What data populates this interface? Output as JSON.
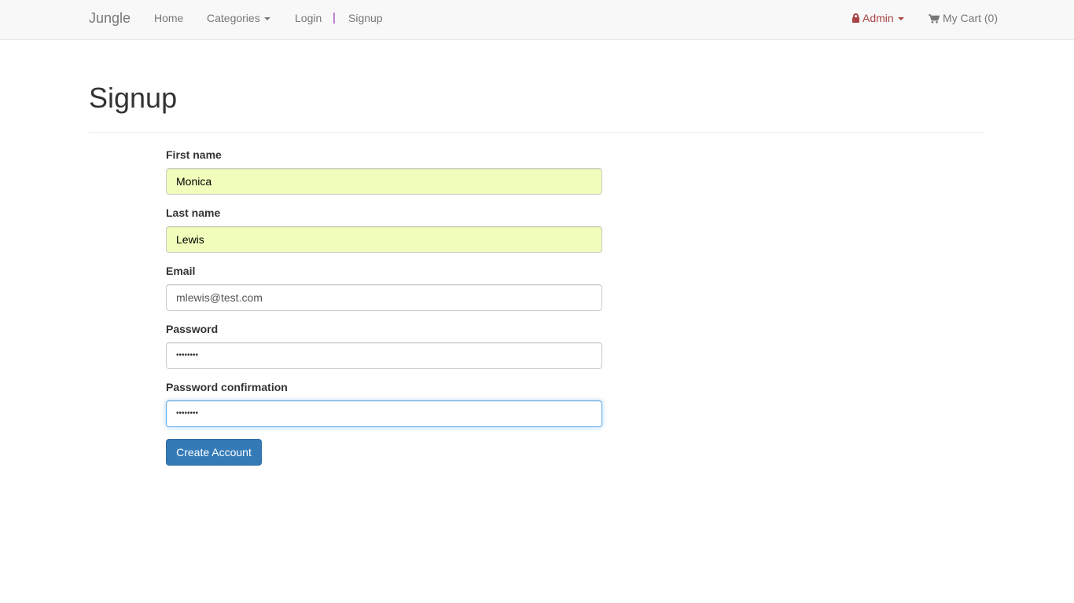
{
  "navbar": {
    "brand": "Jungle",
    "home": "Home",
    "categories": "Categories",
    "login": "Login",
    "separator": "|",
    "signup": "Signup",
    "admin": "Admin",
    "cart": "My Cart (0)"
  },
  "page": {
    "title": "Signup"
  },
  "form": {
    "first_name": {
      "label": "First name",
      "value": "Monica"
    },
    "last_name": {
      "label": "Last name",
      "value": "Lewis"
    },
    "email": {
      "label": "Email",
      "value": "mlewis@test.com"
    },
    "password": {
      "label": "Password",
      "value": "••••••••"
    },
    "password_confirmation": {
      "label": "Password confirmation",
      "value": "••••••••"
    },
    "submit": "Create Account"
  },
  "colors": {
    "navbar_bg": "#f8f8f8",
    "admin_accent": "#a94442",
    "separator": "#9b2fae",
    "autofill_bg": "#f0fdbb",
    "primary_button": "#337ab7",
    "focus_border": "#66afe9"
  },
  "icons": {
    "admin": "lock-icon",
    "cart": "shopping-cart-icon",
    "dropdown": "caret-down-icon"
  }
}
